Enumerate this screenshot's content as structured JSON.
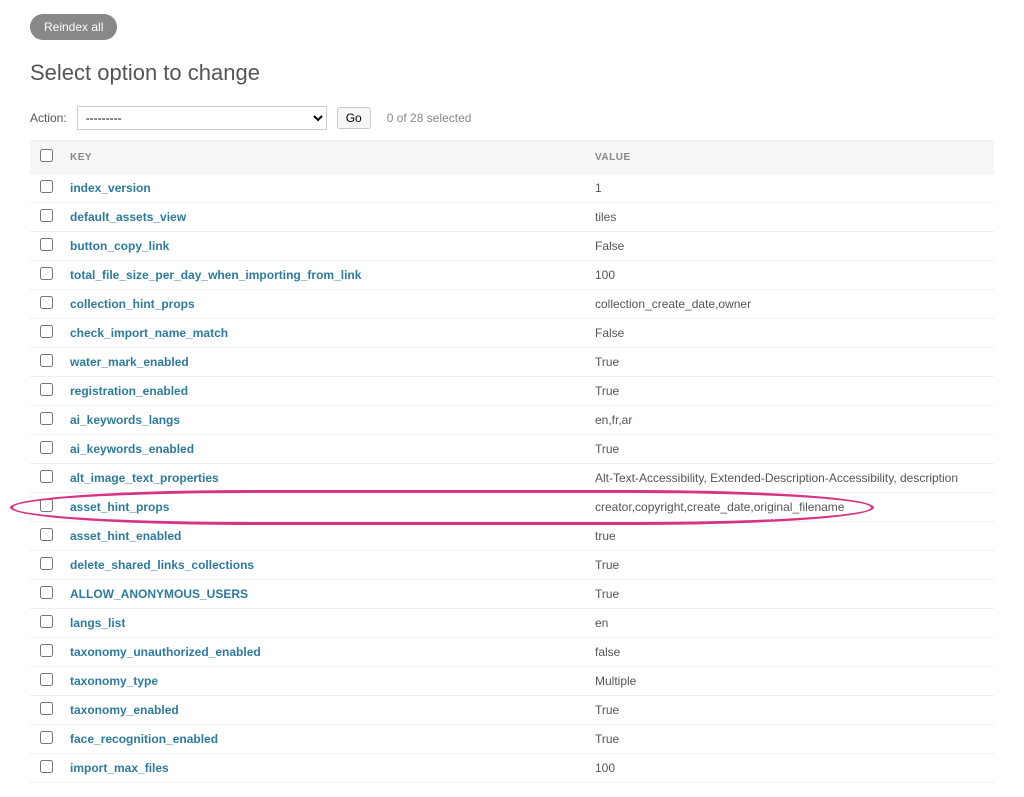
{
  "header": {
    "reindex_label": "Reindex all",
    "page_title": "Select option to change"
  },
  "actions": {
    "label": "Action:",
    "placeholder_option": "---------",
    "go_label": "Go",
    "selection_count": "0 of 28 selected"
  },
  "table": {
    "columns": {
      "key": "KEY",
      "value": "VALUE"
    },
    "rows": [
      {
        "key": "index_version",
        "value": "1"
      },
      {
        "key": "default_assets_view",
        "value": "tiles"
      },
      {
        "key": "button_copy_link",
        "value": "False"
      },
      {
        "key": "total_file_size_per_day_when_importing_from_link",
        "value": "100"
      },
      {
        "key": "collection_hint_props",
        "value": "collection_create_date,owner"
      },
      {
        "key": "check_import_name_match",
        "value": "False"
      },
      {
        "key": "water_mark_enabled",
        "value": "True"
      },
      {
        "key": "registration_enabled",
        "value": "True"
      },
      {
        "key": "ai_keywords_langs",
        "value": "en,fr,ar"
      },
      {
        "key": "ai_keywords_enabled",
        "value": "True"
      },
      {
        "key": "alt_image_text_properties",
        "value": "Alt-Text-Accessibility, Extended-Description-Accessibility, description"
      },
      {
        "key": "asset_hint_props",
        "value": "creator,copyright,create_date,original_filename",
        "highlight": true
      },
      {
        "key": "asset_hint_enabled",
        "value": "true"
      },
      {
        "key": "delete_shared_links_collections",
        "value": "True"
      },
      {
        "key": "ALLOW_ANONYMOUS_USERS",
        "value": "True"
      },
      {
        "key": "langs_list",
        "value": "en"
      },
      {
        "key": "taxonomy_unauthorized_enabled",
        "value": "false"
      },
      {
        "key": "taxonomy_type",
        "value": "Multiple"
      },
      {
        "key": "taxonomy_enabled",
        "value": "True"
      },
      {
        "key": "face_recognition_enabled",
        "value": "True"
      },
      {
        "key": "import_max_files",
        "value": "100"
      }
    ]
  }
}
